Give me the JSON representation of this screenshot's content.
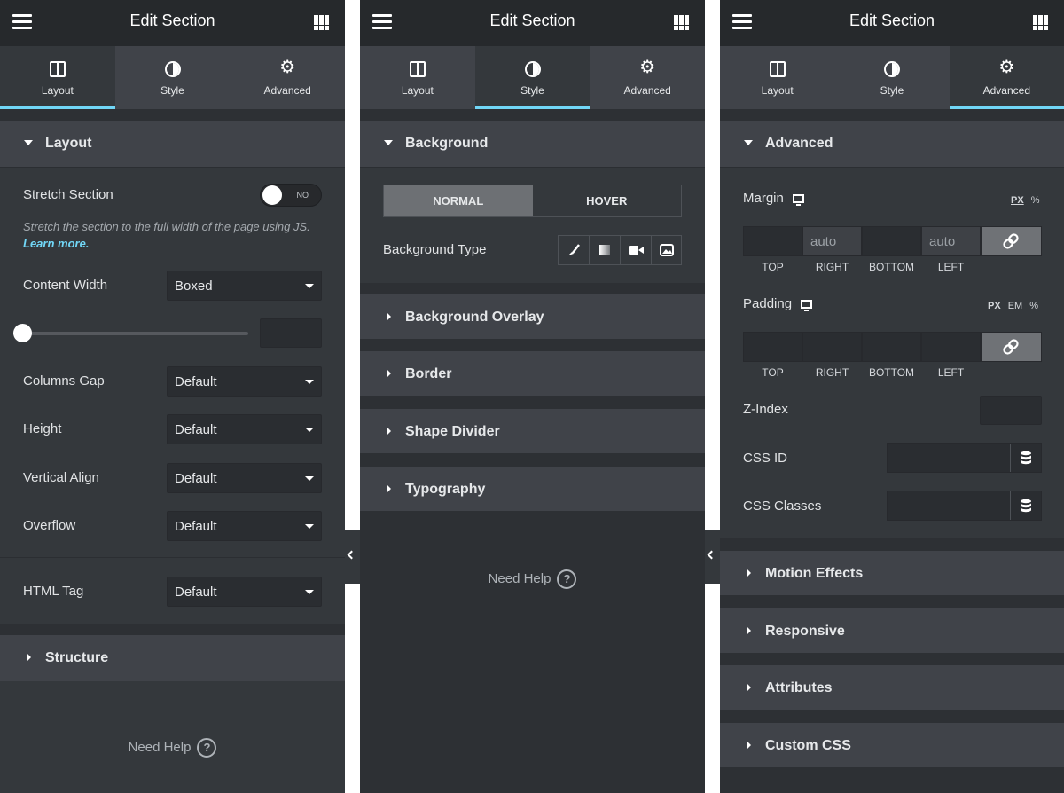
{
  "header": {
    "title": "Edit Section"
  },
  "tabs": [
    "Layout",
    "Style",
    "Advanced"
  ],
  "colors": {
    "accent": "#71d7f7",
    "panel": "#34383c",
    "header": "#26292c"
  },
  "layout_panel": {
    "section_title": "Layout",
    "stretch_label": "Stretch Section",
    "toggle_text": "NO",
    "stretch_desc": "Stretch the section to the full width of the page using JS.",
    "learn_more": "Learn more.",
    "content_width_label": "Content Width",
    "content_width_value": "Boxed",
    "columns_gap_label": "Columns Gap",
    "columns_gap_value": "Default",
    "height_label": "Height",
    "height_value": "Default",
    "vertical_align_label": "Vertical Align",
    "vertical_align_value": "Default",
    "overflow_label": "Overflow",
    "overflow_value": "Default",
    "html_tag_label": "HTML Tag",
    "html_tag_value": "Default",
    "structure_title": "Structure",
    "need_help": "Need Help"
  },
  "style_panel": {
    "background_title": "Background",
    "normal_tab": "NORMAL",
    "hover_tab": "HOVER",
    "bg_type_label": "Background Type",
    "bg_type_icons": [
      "brush-icon",
      "gradient-icon",
      "video-icon",
      "slideshow-icon"
    ],
    "overlay_title": "Background Overlay",
    "border_title": "Border",
    "shape_divider_title": "Shape Divider",
    "typography_title": "Typography",
    "need_help": "Need Help"
  },
  "advanced_panel": {
    "section_title": "Advanced",
    "margin_label": "Margin",
    "margin_units": [
      "PX",
      "%"
    ],
    "margin_values": [
      "",
      "auto",
      "",
      "auto"
    ],
    "padding_label": "Padding",
    "padding_units": [
      "PX",
      "EM",
      "%"
    ],
    "padding_values": [
      "",
      "",
      "",
      ""
    ],
    "side_labels": [
      "TOP",
      "RIGHT",
      "BOTTOM",
      "LEFT"
    ],
    "z_index_label": "Z-Index",
    "css_id_label": "CSS ID",
    "css_classes_label": "CSS Classes",
    "motion_title": "Motion Effects",
    "responsive_title": "Responsive",
    "attributes_title": "Attributes",
    "custom_css_title": "Custom CSS"
  }
}
